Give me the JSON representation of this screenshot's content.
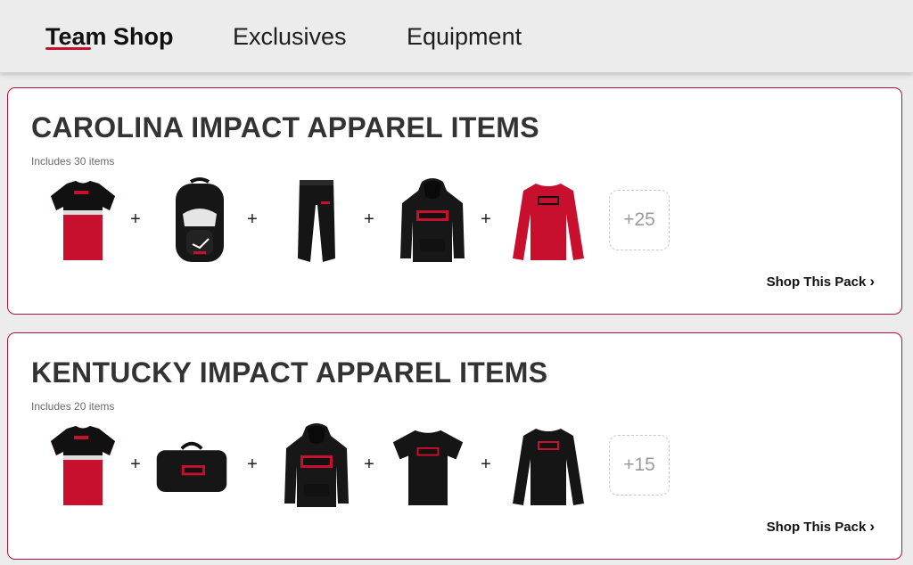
{
  "nav": {
    "tabs": [
      {
        "label": "Team Shop",
        "active": true
      },
      {
        "label": "Exclusives",
        "active": false
      },
      {
        "label": "Equipment",
        "active": false
      }
    ]
  },
  "colors": {
    "accent": "#c8102e",
    "card_border": "#b0123a",
    "background": "#ececec"
  },
  "packs": [
    {
      "title": "CAROLINA IMPACT APPAREL ITEMS",
      "subtitle": "Includes 30 items",
      "products": [
        "jersey-red-black",
        "backpack-black",
        "joggers-black",
        "hoodie-black",
        "long-sleeve-red"
      ],
      "more_label": "+25",
      "shop_label": "Shop This Pack",
      "chevron_icon": "chevron-right-icon"
    },
    {
      "title": "KENTUCKY IMPACT APPAREL ITEMS",
      "subtitle": "Includes 20 items",
      "products": [
        "jersey-red-black",
        "duffel-bag-black",
        "hoodie-black",
        "tshirt-black",
        "long-sleeve-black"
      ],
      "more_label": "+15",
      "shop_label": "Shop This Pack",
      "chevron_icon": "chevron-right-icon"
    }
  ]
}
